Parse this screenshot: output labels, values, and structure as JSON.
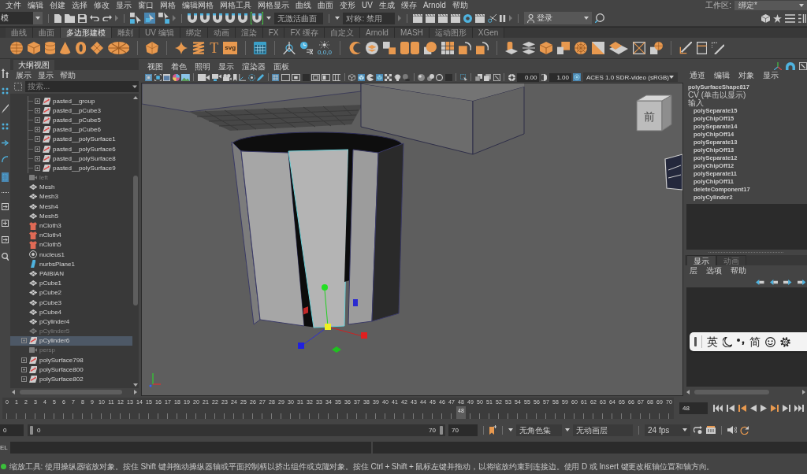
{
  "menubar": {
    "items": [
      "文件",
      "编辑",
      "创建",
      "选择",
      "修改",
      "显示",
      "窗口",
      "网格",
      "编辑网格",
      "网格工具",
      "网格显示",
      "曲线",
      "曲面",
      "变形",
      "UV",
      "生成",
      "缓存",
      "Arnold",
      "帮助"
    ],
    "workspace_label": "工作区:",
    "workspace": "绑定*"
  },
  "status_line": {
    "mode": "模",
    "select_modes": [
      {
        "selected": false
      },
      {
        "selected": true
      },
      {
        "selected": false
      }
    ],
    "snap_toggles": [
      {
        "on": false
      },
      {
        "on": false
      },
      {
        "on": false
      },
      {
        "on": false
      },
      {
        "on": false
      },
      {
        "on": true
      }
    ],
    "live_surface": "无激活曲面",
    "symmetry": "对称: 禁用",
    "login": "登录"
  },
  "shelf": {
    "tabs": [
      {
        "label": "曲线",
        "selected": false
      },
      {
        "label": "曲面",
        "selected": false
      },
      {
        "label": "多边形建模",
        "selected": true
      },
      {
        "label": "雕刻",
        "selected": false
      },
      {
        "label": "UV 编辑",
        "selected": false
      },
      {
        "label": "绑定",
        "selected": false
      },
      {
        "label": "动画",
        "selected": false
      },
      {
        "label": "渲染",
        "selected": false
      },
      {
        "label": "FX",
        "selected": false
      },
      {
        "label": "FX 缓存",
        "selected": false
      },
      {
        "label": "自定义",
        "selected": false
      },
      {
        "label": "Arnold",
        "selected": false
      },
      {
        "label": "MASH",
        "selected": false
      },
      {
        "label": "运动图形",
        "selected": false
      },
      {
        "label": "XGen",
        "selected": false
      }
    ],
    "text_buttons": [
      "T",
      "svg"
    ],
    "icon_caption": "0,0,0"
  },
  "toolbox": {
    "tools": [
      {
        "selected": false
      },
      {
        "selected": false
      },
      {
        "selected": false
      },
      {
        "selected": false
      },
      {
        "selected": false
      },
      {
        "selected": false
      },
      {
        "selected": true
      },
      {
        "selected": false
      },
      {
        "selected": false
      },
      {
        "selected": false
      },
      {
        "selected": false
      },
      {
        "selected": false
      }
    ]
  },
  "outliner": {
    "title": "大纲视图",
    "menu": [
      "展示",
      "显示",
      "帮助"
    ],
    "search": {
      "placeholder": "搜索..."
    },
    "items": [
      {
        "children": [
          {
            "label": "pasted__group",
            "kind": "transform",
            "expandable": true,
            "hidden": false,
            "selected": false
          },
          {
            "label": "pasted__pCube3",
            "kind": "transform",
            "expandable": true,
            "hidden": false,
            "selected": false
          },
          {
            "label": "pasted__pCube5",
            "kind": "transform",
            "expandable": true,
            "hidden": false,
            "selected": false
          },
          {
            "label": "pasted__pCube6",
            "kind": "transform",
            "expandable": true,
            "hidden": false,
            "selected": false
          },
          {
            "label": "pasted__polySurface1",
            "kind": "transform",
            "expandable": true,
            "hidden": false,
            "selected": false
          },
          {
            "label": "pasted__polySurface6",
            "kind": "transform",
            "expandable": true,
            "hidden": false,
            "selected": false
          },
          {
            "label": "pasted__polySurface8",
            "kind": "transform",
            "expandable": true,
            "hidden": false,
            "selected": false
          },
          {
            "label": "pasted__polySurface9",
            "kind": "transform",
            "expandable": true,
            "hidden": false,
            "selected": false
          }
        ]
      },
      {
        "label": "left",
        "kind": "camera",
        "expandable": false,
        "hidden": true,
        "selected": false
      },
      {
        "label": "Mesh",
        "kind": "mesh",
        "expandable": false,
        "hidden": false,
        "selected": false
      },
      {
        "label": "Mesh3",
        "kind": "mesh",
        "expandable": false,
        "hidden": false,
        "selected": false
      },
      {
        "label": "Mesh4",
        "kind": "mesh",
        "expandable": false,
        "hidden": false,
        "selected": false
      },
      {
        "label": "Mesh5",
        "kind": "mesh",
        "expandable": false,
        "hidden": false,
        "selected": false
      },
      {
        "label": "nCloth3",
        "kind": "ncloth",
        "expandable": false,
        "hidden": false,
        "selected": false
      },
      {
        "label": "nCloth4",
        "kind": "ncloth",
        "expandable": false,
        "hidden": false,
        "selected": false
      },
      {
        "label": "nCloth5",
        "kind": "ncloth",
        "expandable": false,
        "hidden": false,
        "selected": false
      },
      {
        "label": "nucleus1",
        "kind": "nucleus",
        "expandable": false,
        "hidden": false,
        "selected": false
      },
      {
        "label": "nurbsPlane1",
        "kind": "nurbs",
        "expandable": false,
        "hidden": false,
        "selected": false
      },
      {
        "label": "PAIBIAN",
        "kind": "mesh",
        "expandable": false,
        "hidden": false,
        "selected": false
      },
      {
        "label": "pCube1",
        "kind": "mesh",
        "expandable": false,
        "hidden": false,
        "selected": false
      },
      {
        "label": "pCube2",
        "kind": "mesh",
        "expandable": false,
        "hidden": false,
        "selected": false
      },
      {
        "label": "pCube3",
        "kind": "mesh",
        "expandable": false,
        "hidden": false,
        "selected": false
      },
      {
        "label": "pCube4",
        "kind": "mesh",
        "expandable": false,
        "hidden": false,
        "selected": false
      },
      {
        "label": "pCylinder4",
        "kind": "mesh",
        "expandable": false,
        "hidden": false,
        "selected": false
      },
      {
        "label": "pCylinder5",
        "kind": "mesh",
        "expandable": false,
        "hidden": true,
        "selected": false
      },
      {
        "label": "pCylinder6",
        "kind": "transform",
        "expandable": true,
        "hidden": false,
        "selected": true
      },
      {
        "label": "persp",
        "kind": "camera",
        "expandable": false,
        "hidden": true,
        "selected": false
      },
      {
        "label": "polySurface798",
        "kind": "transform",
        "expandable": true,
        "hidden": false,
        "selected": false
      },
      {
        "label": "polySurface800",
        "kind": "transform",
        "expandable": true,
        "hidden": false,
        "selected": false
      },
      {
        "label": "polySurface802",
        "kind": "transform",
        "expandable": true,
        "hidden": false,
        "selected": false
      }
    ]
  },
  "viewport": {
    "menu": [
      "视图",
      "着色",
      "照明",
      "显示",
      "渲染器",
      "面板"
    ],
    "toolbar": [
      {
        "on": true
      },
      {
        "on": false
      },
      {
        "on": false
      },
      {
        "on": false
      },
      {
        "on": false
      },
      {
        "on": false
      },
      {
        "on": false
      },
      {
        "on": false
      },
      {
        "on": false
      },
      {
        "on": false
      },
      {
        "on": false
      },
      {
        "on": false
      },
      {
        "on": true
      },
      {
        "on": false
      },
      {
        "on": false
      },
      {
        "on": false
      },
      {
        "on": false
      },
      {
        "on": false
      },
      {
        "on": false
      },
      {
        "on": false
      },
      {
        "on": true
      },
      {
        "on": false
      },
      {
        "on": true
      },
      {
        "on": false
      },
      {
        "on": false
      },
      {
        "on": false
      },
      {
        "on": false
      },
      {
        "on": false
      },
      {
        "on": false
      },
      {
        "on": false
      },
      {
        "on": false
      },
      {
        "on": false
      },
      {
        "on": false
      },
      {
        "on": false
      }
    ],
    "exposure": "0.00",
    "gamma": "1.00",
    "color_management": true,
    "color_space": "ACES 1.0 SDR-video (sRGB)",
    "view_cube": "前"
  },
  "channel_box": {
    "menu": [
      "通道",
      "编辑",
      "对象",
      "显示"
    ],
    "shape": "polySurfaceShape817",
    "cv": "CV (单击以显示)",
    "inputs_heading": "输入",
    "inputs": [
      "polySeparate15",
      "polyChipOff15",
      "polySeparate14",
      "polyChipOff14",
      "polySeparate13",
      "polyChipOff13",
      "polySeparate12",
      "polyChipOff12",
      "polySeparate11",
      "polyChipOff11",
      "deleteComponent17",
      "polyCylinder2"
    ]
  },
  "layer_editor": {
    "tabs": [
      {
        "label": "显示",
        "selected": true
      },
      {
        "label": "动画",
        "selected": false
      }
    ],
    "menu": [
      "层",
      "选项",
      "帮助"
    ]
  },
  "ime_bar": {
    "language": "英",
    "charset": "简"
  },
  "time_slider": {
    "frames": [
      "0",
      "1",
      "2",
      "3",
      "4",
      "5",
      "6",
      "7",
      "8",
      "9",
      "10",
      "11",
      "12",
      "13",
      "14",
      "15",
      "16",
      "17",
      "18",
      "19",
      "20",
      "21",
      "22",
      "23",
      "24",
      "25",
      "26",
      "27",
      "28",
      "29",
      "30",
      "31",
      "32",
      "33",
      "34",
      "35",
      "36",
      "37",
      "38",
      "39",
      "40",
      "41",
      "42",
      "43",
      "44",
      "45",
      "46",
      "47",
      "48",
      "49",
      "50",
      "51",
      "52",
      "53",
      "54",
      "55",
      "56",
      "57",
      "58",
      "59",
      "60",
      "61",
      "62",
      "63",
      "64",
      "65",
      "66",
      "67",
      "68",
      "69",
      "70"
    ],
    "playhead": {
      "level": 0.6857,
      "label": "48"
    },
    "current_frame": "48"
  },
  "range_slider": {
    "start": "0",
    "level": 1,
    "range_start": "0",
    "range_end": "70",
    "end": "70",
    "character_set": "无角色集",
    "anim_layer": "无动画层",
    "fps": "24 fps"
  },
  "command_line": {
    "language": "EL"
  },
  "help_line": {
    "text": "缩放工具: 使用操纵器缩放对象。按住 Shift 键并拖动操纵器轴或平面控制柄以挤出组件或克隆对象。按住 Ctrl + Shift + 鼠标左键并拖动，以将缩放约束到连接边。使用 D 或 Insert 键更改枢轴位置和轴方向。"
  }
}
